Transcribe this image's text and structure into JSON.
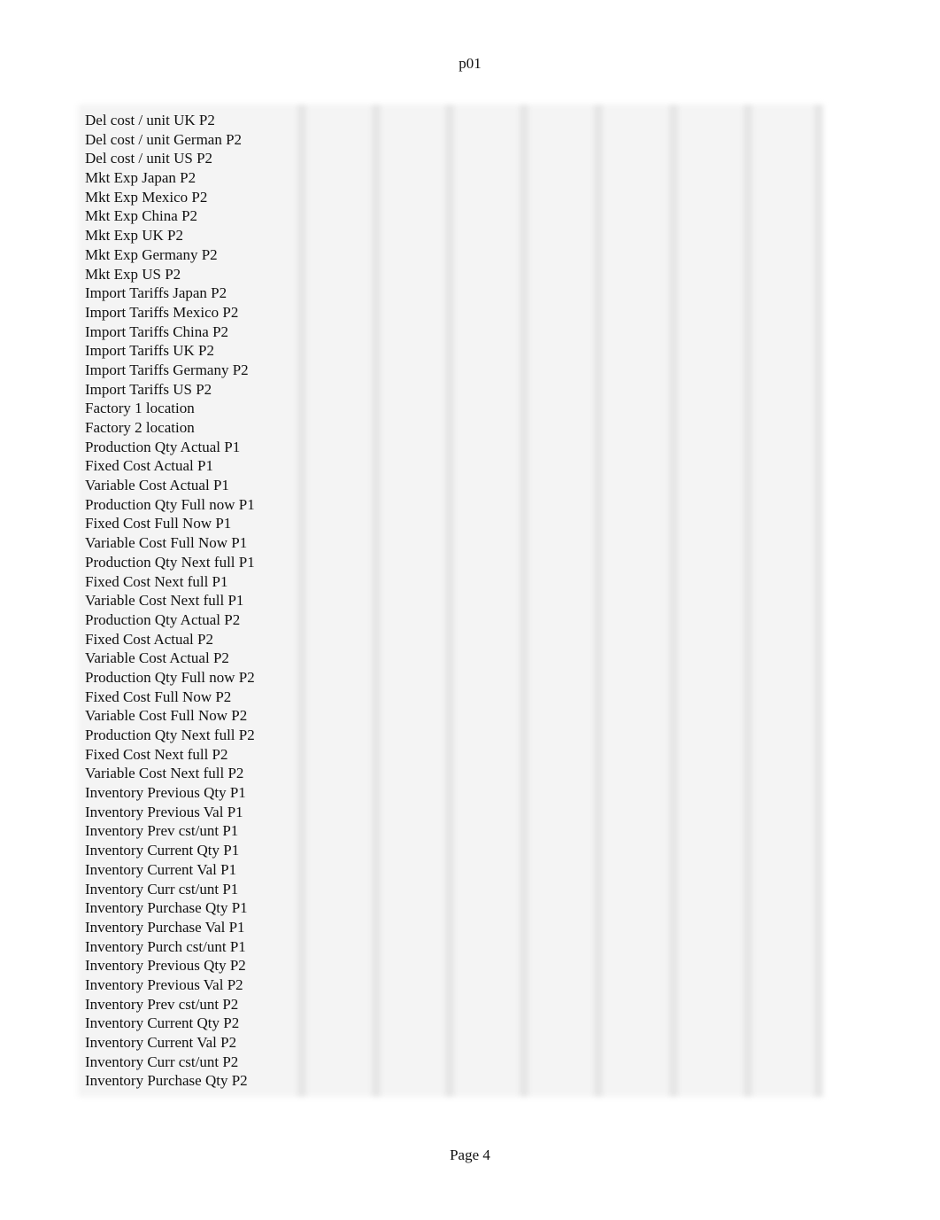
{
  "header": {
    "title": "p01"
  },
  "rows": [
    "Del cost / unit UK P2",
    "Del cost / unit German P2",
    "Del cost / unit US P2",
    "Mkt Exp Japan P2",
    "Mkt Exp Mexico P2",
    "Mkt Exp China P2",
    "Mkt Exp UK P2",
    "Mkt Exp Germany P2",
    "Mkt Exp US P2",
    "Import Tariffs Japan P2",
    "Import Tariffs Mexico P2",
    "Import Tariffs China P2",
    "Import Tariffs UK P2",
    "Import Tariffs Germany P2",
    "Import Tariffs US P2",
    "Factory 1 location",
    "Factory 2 location",
    "Production Qty Actual P1",
    "Fixed Cost Actual P1",
    "Variable Cost Actual P1",
    "Production Qty Full now P1",
    "Fixed Cost Full Now P1",
    "Variable Cost Full Now P1",
    "Production Qty Next full P1",
    "Fixed Cost Next full P1",
    "Variable Cost Next full P1",
    "Production Qty Actual P2",
    "Fixed Cost Actual P2",
    "Variable Cost Actual P2",
    "Production Qty Full now P2",
    "Fixed Cost Full Now P2",
    "Variable Cost Full Now P2",
    "Production Qty Next full P2",
    "Fixed Cost Next full P2",
    "Variable Cost Next full P2",
    "Inventory Previous Qty P1",
    "Inventory Previous Val P1",
    "Inventory Prev cst/unt P1",
    "Inventory Current Qty P1",
    "Inventory Current Val P1",
    "Inventory Curr cst/unt P1",
    "Inventory Purchase Qty P1",
    "Inventory Purchase Val P1",
    "Inventory Purch cst/unt P1",
    "Inventory Previous Qty P2",
    "Inventory Previous Val P2",
    "Inventory Prev cst/unt P2",
    "Inventory Current Qty P2",
    "Inventory Current Val P2",
    "Inventory Curr cst/unt P2",
    "Inventory Purchase Qty P2"
  ],
  "footer": {
    "page": "Page 4"
  }
}
